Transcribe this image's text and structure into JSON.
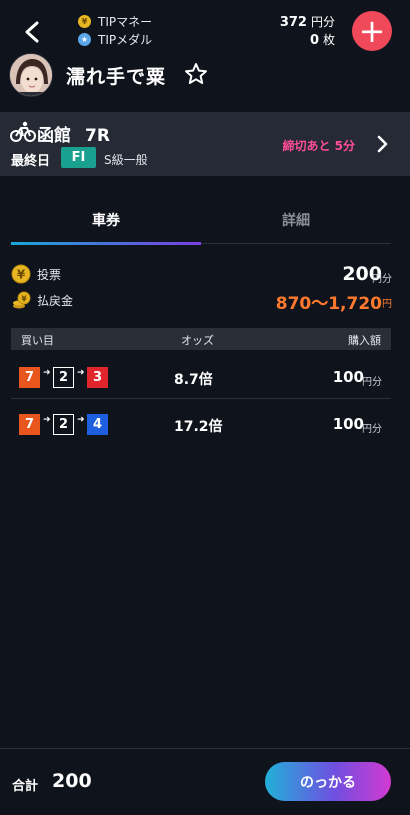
{
  "header": {
    "tip_money_label": "TIPマネー",
    "tip_money_value": "372",
    "tip_money_unit": "円分",
    "tip_medal_label": "TIPメダル",
    "tip_medal_value": "0",
    "tip_medal_unit": "枚",
    "coin_symbol": "¥",
    "medal_symbol": "★",
    "add_symbol": "+",
    "horse_name": "濡れ手で粟"
  },
  "race": {
    "venue": "函館",
    "race_number": "7R",
    "day": "最終日",
    "grade": "FI",
    "class": "S級一般",
    "deadline": "締切あと 5分"
  },
  "tabs": [
    {
      "label": "車券"
    },
    {
      "label": "詳細"
    }
  ],
  "summary": {
    "stake_label": "投票",
    "stake_value": "200",
    "stake_unit": "円分",
    "payout_label": "払戻金",
    "payout_value": "870〜1,720",
    "payout_unit": "円"
  },
  "bets": {
    "headers": {
      "combo": "買い目",
      "odds": "オッズ",
      "amount": "購入額"
    },
    "rows": [
      {
        "combo": [
          "7",
          "2",
          "3"
        ],
        "odds": "8.7倍",
        "amount": "100",
        "unit": "円分"
      },
      {
        "combo": [
          "7",
          "2",
          "4"
        ],
        "odds": "17.2倍",
        "amount": "100",
        "unit": "円分"
      }
    ],
    "arrow": "➜"
  },
  "footer": {
    "total_label": "合計",
    "total_value": "200",
    "submit_label": "のっかる"
  },
  "colors": {
    "background": "#0f131b",
    "accent_add": "#f0495a",
    "deadline": "#ff4d9a",
    "payout": "#ff7a2e",
    "grade_badge": "#1aa08e",
    "bracket_7": "#e8561e",
    "bracket_2": "#0f131b",
    "bracket_3": "#e0252b",
    "bracket_4": "#1e5fe0"
  },
  "icons": {
    "back": "chevron-left-icon",
    "coin": "yen-coin-icon",
    "medal": "star-medal-icon",
    "add": "plus-icon",
    "favorite": "star-outline-icon",
    "bicycle": "bicycle-icon",
    "chevron": "chevron-right-icon"
  }
}
